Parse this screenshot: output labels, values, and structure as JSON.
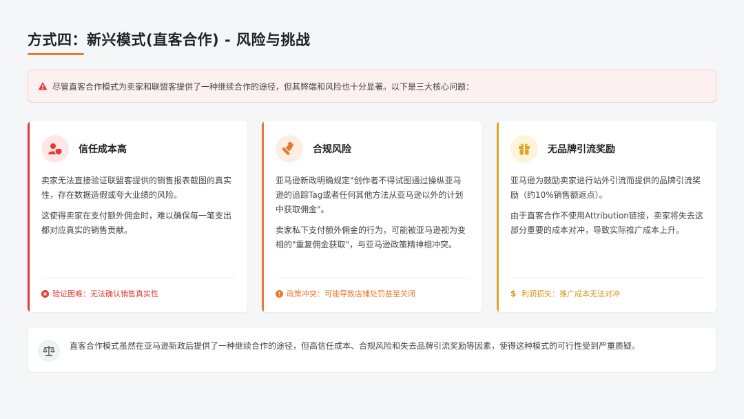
{
  "header": {
    "title": "方式四：新兴模式(直客合作) - 风险与挑战"
  },
  "alert": {
    "icon": "warning-triangle-icon",
    "text": "尽管直客合作模式为卖家和联盟客提供了一种继续合作的途径，但其弊端和风险也十分显著。以下是三大核心问题："
  },
  "cards": [
    {
      "title": "信任成本高",
      "icon": "user-shield-icon",
      "accent": "#e53935",
      "paragraphs": [
        "卖家无法直接验证联盟客提供的销售报表截图的真实性，存在数据造假或夸大业绩的风险。",
        "这使得卖家在支付额外佣金时，难以确保每一笔支出都对应真实的销售贡献。"
      ],
      "footer": "验证困难：无法确认销售真实性"
    },
    {
      "title": "合规风险",
      "icon": "gavel-icon",
      "accent": "#e8792f",
      "paragraphs": [
        "亚马逊新政明确规定\"创作者不得试图通过操纵亚马逊的追踪Tag或者任何其他方法从亚马逊以外的计划中获取佣金\"。",
        "卖家私下支付额外佣金的行为，可能被亚马逊视为变相的\"重复佣金获取\"，与亚马逊政策精神相冲突。"
      ],
      "footer": "政策冲突：可能导致店铺处罚甚至关闭"
    },
    {
      "title": "无品牌引流奖励",
      "icon": "gift-icon",
      "accent": "#e0a526",
      "paragraphs": [
        "亚马逊为鼓励卖家进行站外引流而提供的品牌引流奖励（约10%销售额返点）。",
        "由于直客合作不使用Attribution链接，卖家将失去这部分重要的成本对冲，导致实际推广成本上升。"
      ],
      "footer": "利润损失：推广成本无法对冲"
    }
  ],
  "summary": {
    "icon": "balance-scale-icon",
    "text": "直客合作模式虽然在亚马逊新政后提供了一种继续合作的途径，但高信任成本、合规风险和失去品牌引流奖励等因素，使得这种模式的可行性受到严重质疑。"
  }
}
